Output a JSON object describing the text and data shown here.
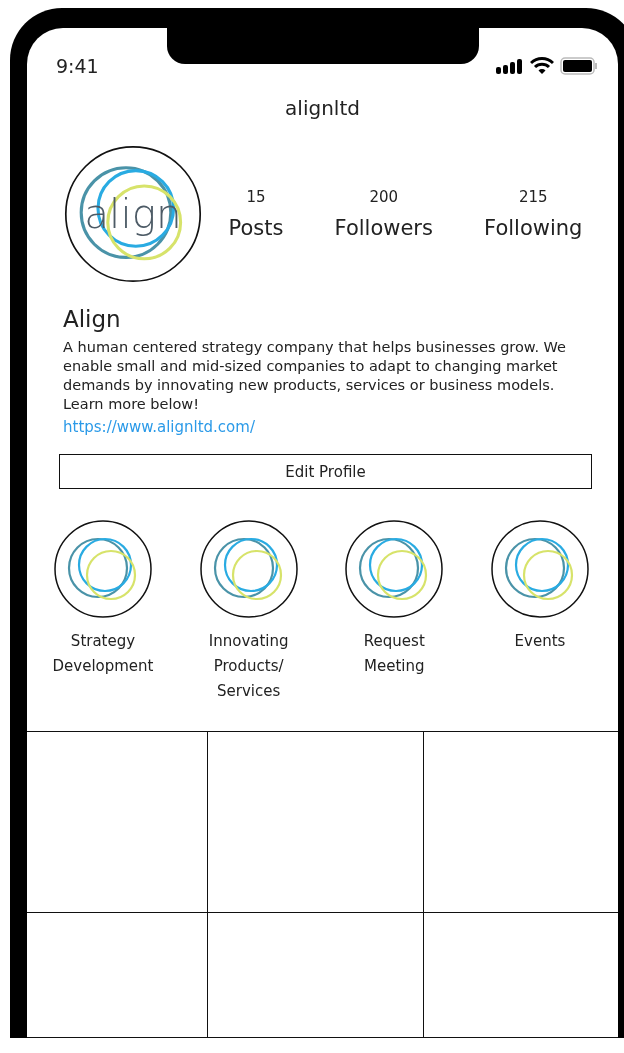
{
  "status_bar": {
    "time": "9:41"
  },
  "username": "alignltd",
  "profile": {
    "logo_text": "align",
    "stats": [
      {
        "value": "15",
        "label": "Posts"
      },
      {
        "value": "200",
        "label": "Followers"
      },
      {
        "value": "215",
        "label": "Following"
      }
    ]
  },
  "name": "Align",
  "bio": "A human centered strategy company that helps businesses grow. We enable small and mid-sized companies to adapt to changing market demands by innovating new products, services or business models.\nLearn more below!",
  "link": "https://www.alignltd.com/",
  "edit_button": "Edit Profile",
  "highlights": [
    {
      "label": "Strategy Development"
    },
    {
      "label": "Innovating Products/ Services"
    },
    {
      "label": "Request Meeting"
    },
    {
      "label": "Events"
    }
  ],
  "posts": [
    {
      "kind": "tile"
    },
    {
      "kind": "tile"
    },
    {
      "kind": "tile"
    },
    {
      "kind": "tile"
    },
    {
      "kind": "tile"
    },
    {
      "kind": "tile"
    }
  ]
}
